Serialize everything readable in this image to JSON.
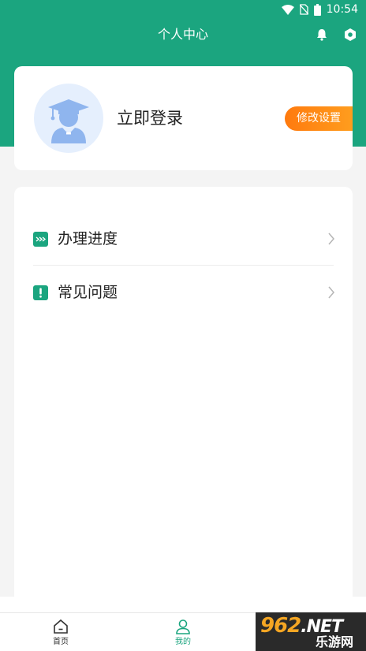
{
  "status_bar": {
    "time": "10:54"
  },
  "header": {
    "title": "个人中心"
  },
  "profile": {
    "login_text": "立即登录",
    "settings_button": "修改设置"
  },
  "menu": {
    "items": [
      {
        "label": "办理进度",
        "icon": "progress-icon"
      },
      {
        "label": "常见问题",
        "icon": "faq-icon"
      }
    ]
  },
  "tabbar": {
    "tabs": [
      {
        "label": "首页",
        "icon": "home-icon"
      },
      {
        "label": "我的",
        "icon": "user-icon"
      }
    ],
    "active_index": 1
  },
  "watermark": {
    "main": "962",
    "net": ".NET",
    "sub": "乐游网"
  },
  "colors": {
    "brand": "#1ba57f",
    "accent": "#ff8a16",
    "avatar_bg": "#e5effd"
  }
}
